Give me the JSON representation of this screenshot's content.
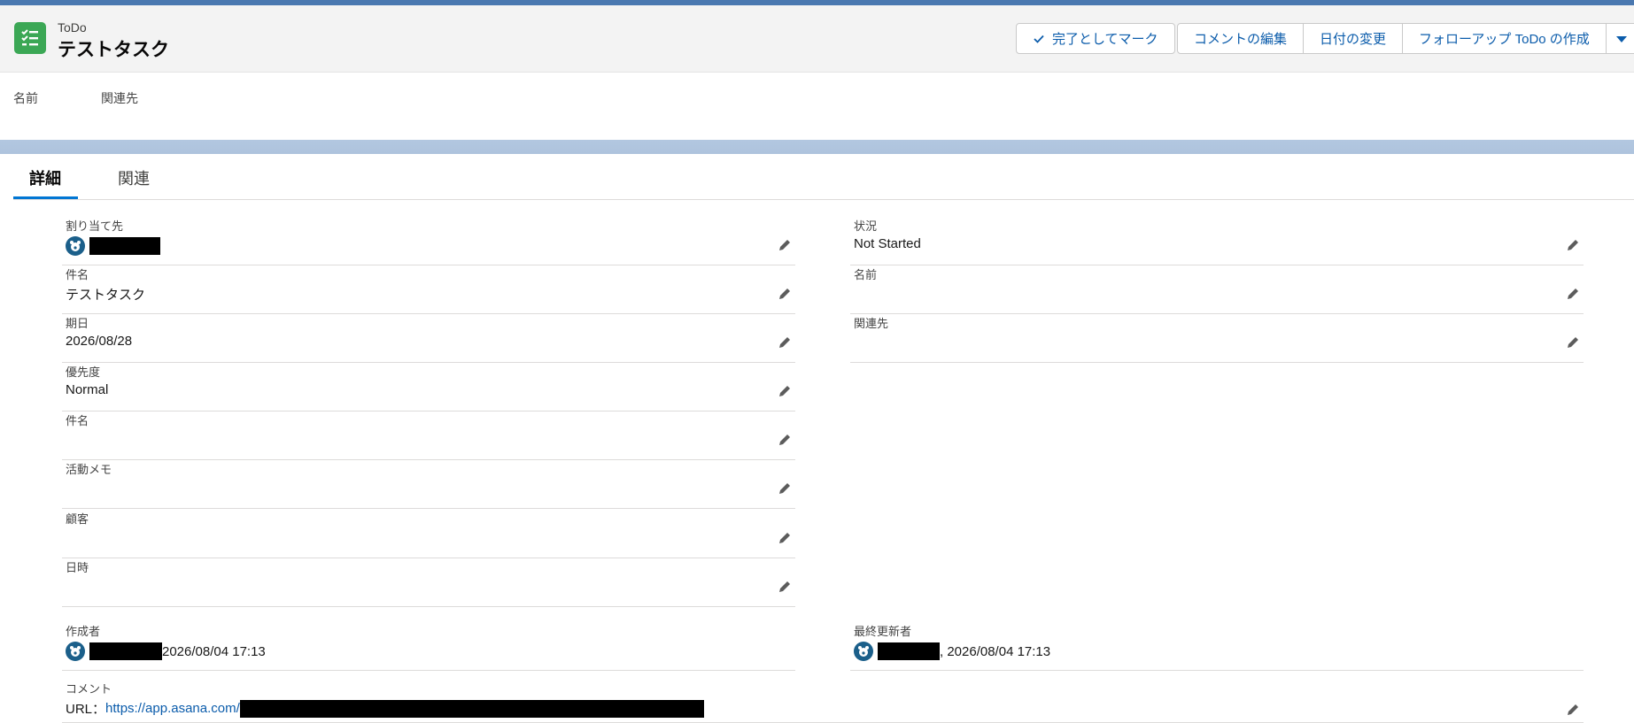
{
  "header": {
    "object_type": "ToDo",
    "title": "テストタスク",
    "icon": "task-list-icon",
    "actions": {
      "mark_complete": "完了としてマーク",
      "edit_comment": "コメントの編集",
      "change_date": "日付の変更",
      "create_followup": "フォローアップ ToDo の作成"
    }
  },
  "highlights": {
    "name_label": "名前",
    "related_label": "関連先"
  },
  "tabs": [
    "詳細",
    "関連"
  ],
  "fields_left": [
    {
      "label": "割り当て先",
      "value": ""
    },
    {
      "label": "件名",
      "value": "テストタスク"
    },
    {
      "label": "期日",
      "value": "2026/08/28"
    },
    {
      "label": "優先度",
      "value": "Normal"
    },
    {
      "label": "件名",
      "value": ""
    },
    {
      "label": "活動メモ",
      "value": ""
    },
    {
      "label": "顧客",
      "value": ""
    },
    {
      "label": "日時",
      "value": ""
    }
  ],
  "fields_right": [
    {
      "label": "状況",
      "value": "Not Started"
    },
    {
      "label": "名前",
      "value": ""
    },
    {
      "label": "関連先",
      "value": ""
    }
  ],
  "created_by": {
    "label": "作成者",
    "timestamp": "2026/08/04 17:13"
  },
  "last_modified_by": {
    "label": "最終更新者",
    "timestamp": ", 2026/08/04 17:13"
  },
  "comment": {
    "label": "コメント",
    "prefix": "URL：",
    "url": "https://app.asana.com/"
  },
  "colors": {
    "accent": "#0176d3",
    "link": "#0b5cab",
    "task_icon_bg": "#3ba755"
  }
}
